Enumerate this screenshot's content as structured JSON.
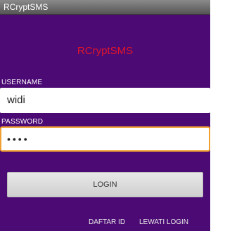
{
  "window": {
    "title": "RCryptSMS"
  },
  "header": {
    "app_name": "RCryptSMS"
  },
  "form": {
    "username_label": "USERNAME",
    "username_value": "widi",
    "password_label": "PASSWORD",
    "password_masked": "••••"
  },
  "actions": {
    "login_label": "LOGIN",
    "register_label": "DAFTAR ID",
    "skip_label": "LEWATI LOGIN"
  },
  "colors": {
    "background": "#4b0a74",
    "app_name": "#e0162b",
    "focused_field_border": "#f0a030"
  }
}
